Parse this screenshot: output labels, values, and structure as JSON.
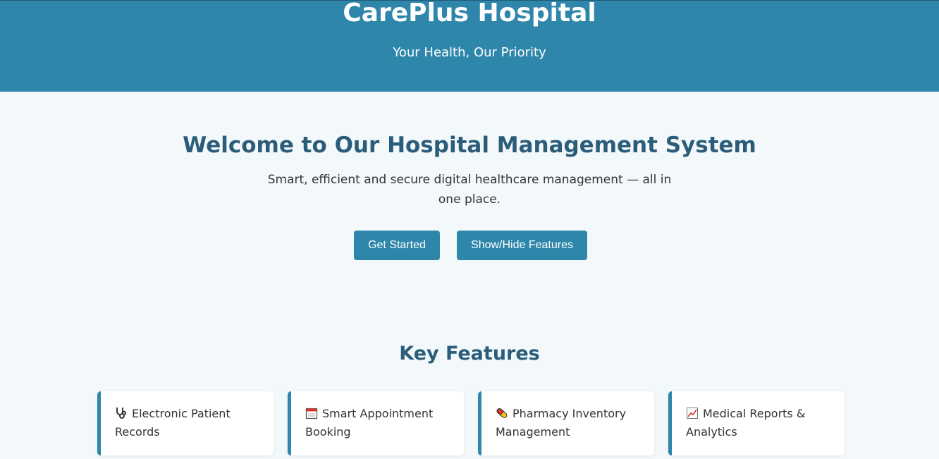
{
  "header": {
    "title": "CarePlus Hospital",
    "tagline": "Your Health, Our Priority"
  },
  "hero": {
    "title": "Welcome to Our Hospital Management System",
    "subtitle": "Smart, efficient and secure digital healthcare management — all in one place.",
    "get_started_label": "Get Started",
    "toggle_features_label": "Show/Hide Features"
  },
  "features": {
    "title": "Key Features",
    "items": [
      {
        "icon": "stethoscope-icon",
        "label": "Electronic Patient Records"
      },
      {
        "icon": "calendar-icon",
        "label": "Smart Appointment Booking"
      },
      {
        "icon": "pill-icon",
        "label": "Pharmacy Inventory Management"
      },
      {
        "icon": "chart-increasing-icon",
        "label": "Medical Reports & Analytics"
      }
    ]
  },
  "colors": {
    "header_bg": "#2e86ab",
    "accent": "#2e86ab",
    "heading": "#2b5d7a",
    "page_bg": "#f3f8fa"
  }
}
